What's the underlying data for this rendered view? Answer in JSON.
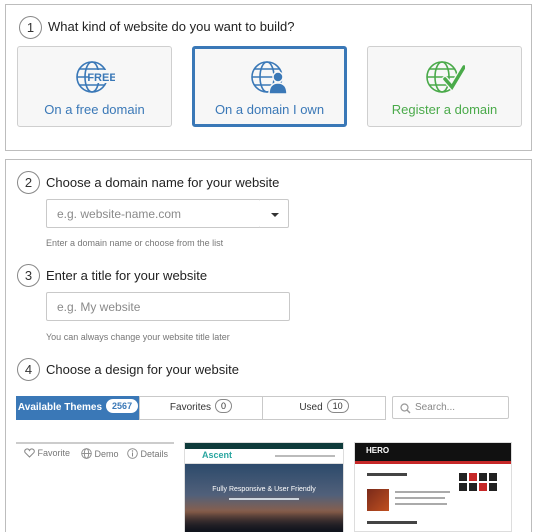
{
  "step1": {
    "number": "1",
    "title": "What kind of website do you want to build?",
    "options": [
      {
        "label": "On a free domain",
        "icon": "globe-free-icon",
        "color": "#3a78b7",
        "selected": false
      },
      {
        "label": "On a domain I own",
        "icon": "globe-user-icon",
        "color": "#3a78b7",
        "selected": true
      },
      {
        "label": "Register a domain",
        "icon": "globe-check-icon",
        "color": "#4aaa4a",
        "selected": false
      }
    ],
    "free_badge": "FREE"
  },
  "step2": {
    "number": "2",
    "title": "Choose a domain name for your website",
    "placeholder": "e.g. website-name.com",
    "help": "Enter a domain name or choose from the list"
  },
  "step3": {
    "number": "3",
    "title": "Enter a title for your website",
    "placeholder": "e.g. My website",
    "help": "You can always change your website title later"
  },
  "step4": {
    "number": "4",
    "title": "Choose a design for your website",
    "tabs": [
      {
        "label": "Available Themes",
        "count": "2567",
        "active": true
      },
      {
        "label": "Favorites",
        "count": "0",
        "active": false
      },
      {
        "label": "Used",
        "count": "10",
        "active": false
      }
    ],
    "search_placeholder": "Search...",
    "card_actions": {
      "favorite": "Favorite",
      "demo": "Demo",
      "details": "Details"
    },
    "themes": [
      {
        "name": "Ascent",
        "headline": "Fully Responsive & User Friendly"
      },
      {
        "name": "HERO"
      }
    ]
  },
  "colors": {
    "accent": "#3a78b7",
    "success": "#4aaa4a"
  }
}
